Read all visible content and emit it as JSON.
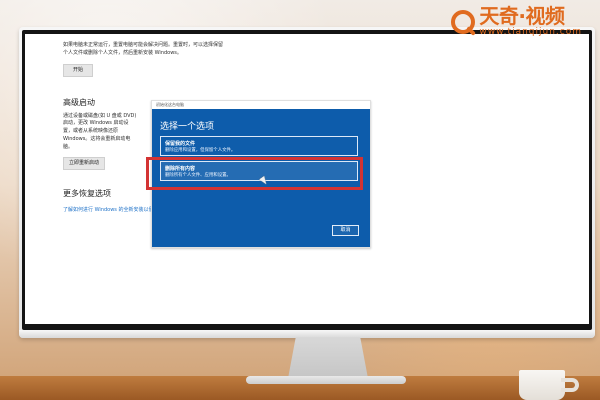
{
  "branding": {
    "title": "天奇·视频",
    "subtitle": "www.tianqijun.com"
  },
  "settings": {
    "intro": "如果电脑未正常运行，重置电脑可能会解决问题。重置时，可以选择保留个人文件或删除个人文件，然后重新安装 Windows。",
    "start_button": "开始",
    "advanced_startup_title": "高级启动",
    "advanced_startup_text": "通过设备或磁盘(如 U 盘或 DVD)启动，更改 Windows 启动设置，或者从系统映像还原 Windows。这将会重新启动电脑。",
    "restart_button": "立即重新启动",
    "more_recovery_title": "更多恢复选项",
    "more_recovery_link": "了解如何进行 Windows 的全新安装以便开始..."
  },
  "dialog": {
    "window_title": "初始化这台电脑",
    "heading": "选择一个选项",
    "options": [
      {
        "title": "保留我的文件",
        "description": "删除应用和设置，但保留个人文件。"
      },
      {
        "title": "删除所有内容",
        "description": "删除所有个人文件、应用和设置。"
      }
    ],
    "cancel_button": "取消"
  },
  "icons": {
    "brand": "search-icon",
    "pointer": "cursor-icon"
  },
  "colors": {
    "dialog_blue": "#0d5cab",
    "highlight_red": "#d33333",
    "link_blue": "#1f72c8",
    "brand_orange": "#e06b1f"
  }
}
